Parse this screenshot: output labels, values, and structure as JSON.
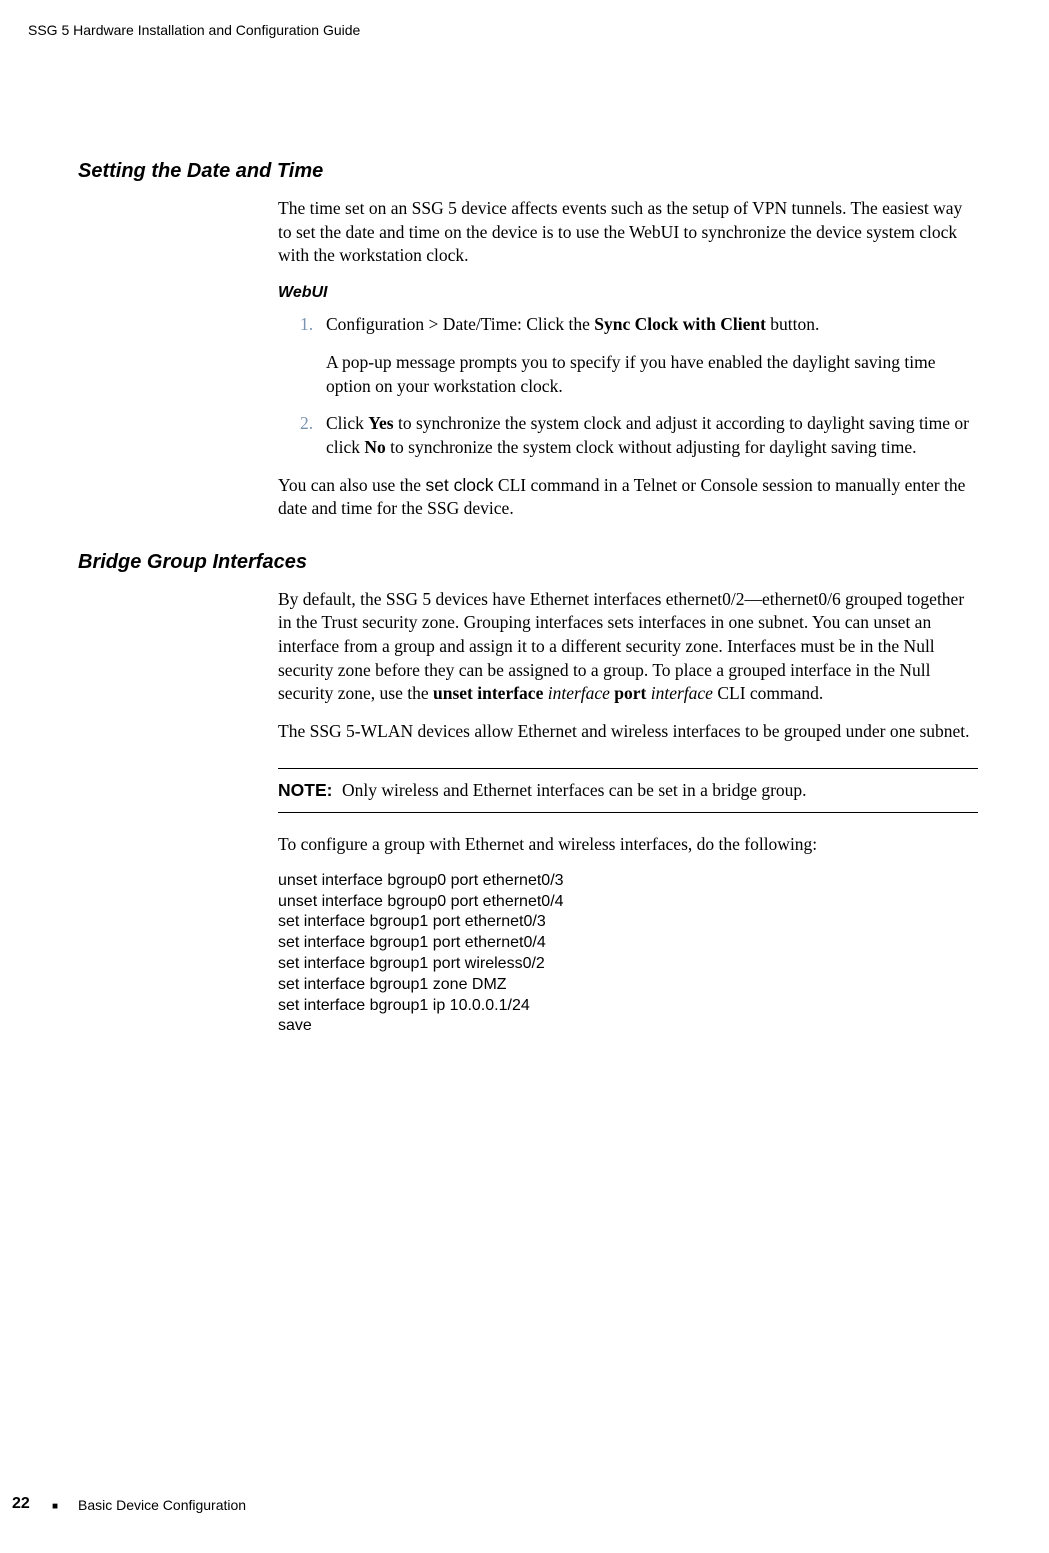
{
  "running_header": "SSG 5 Hardware Installation and Configuration Guide",
  "section1": {
    "title": "Setting the Date and Time",
    "intro": "The time set on an SSG 5 device affects events such as the setup of VPN tunnels. The easiest way to set the date and time on the device is to use the WebUI to synchronize the device system clock with the workstation clock.",
    "webui_label": "WebUI",
    "step1_num": "1.",
    "step1_pre": "Configuration > Date/Time: Click the ",
    "step1_bold": "Sync Clock with Client",
    "step1_post": " button.",
    "step1_sub": "A pop-up message prompts you to specify if you have enabled the daylight saving time option on your workstation clock.",
    "step2_num": "2.",
    "step2_pre": "Click ",
    "step2_b1": "Yes",
    "step2_mid": " to synchronize the system clock and adjust it according to daylight saving time or click ",
    "step2_b2": "No",
    "step2_post": " to synchronize the system clock without adjusting for daylight saving time.",
    "tail_pre": "You can also use the ",
    "tail_mono": "set clock",
    "tail_post": " CLI command in a Telnet or Console session to manually enter the date and time for the SSG device."
  },
  "section2": {
    "title": "Bridge Group Interfaces",
    "p1_pre": "By default, the SSG 5 devices have Ethernet interfaces ethernet0/2—ethernet0/6 grouped together in the Trust security zone. Grouping interfaces sets interfaces in one subnet. You can unset an interface from a group and assign it to a different security zone. Interfaces must be in the Null security zone before they can be assigned to a group. To place a grouped interface in the Null security zone, use the ",
    "p1_b1": "unset interface",
    "p1_i1": " interface ",
    "p1_b2": "port",
    "p1_i2": " interface",
    "p1_post": " CLI command.",
    "p2": "The SSG 5-WLAN devices allow Ethernet and wireless interfaces to be grouped under one subnet.",
    "note_label": "NOTE:",
    "note_text": "Only wireless and Ethernet interfaces can be set in a bridge group.",
    "p3": "To configure a group with Ethernet and wireless interfaces, do the following:",
    "code": "unset interface bgroup0 port ethernet0/3\nunset interface bgroup0 port ethernet0/4\nset interface bgroup1 port ethernet0/3\nset interface bgroup1 port ethernet0/4\nset interface bgroup1 port wireless0/2\nset interface bgroup1 zone DMZ\nset interface bgroup1 ip 10.0.0.1/24\nsave"
  },
  "footer": {
    "page": "22",
    "bullet": "■",
    "text": "Basic Device Configuration"
  }
}
